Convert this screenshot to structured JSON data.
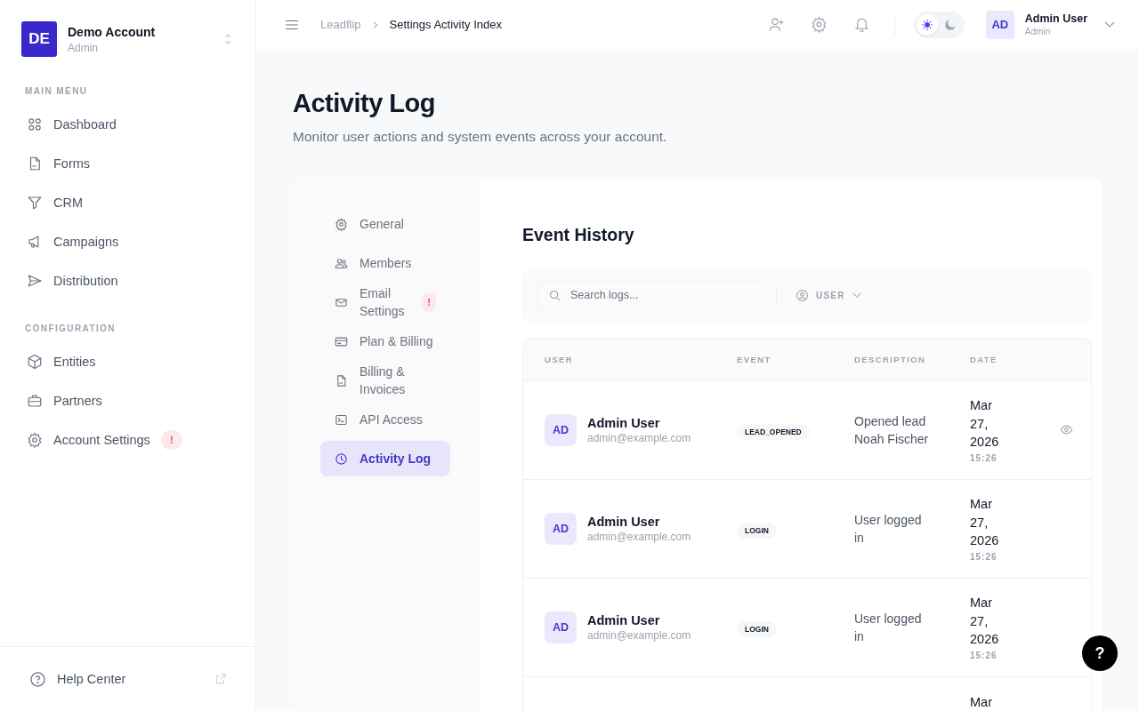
{
  "account": {
    "initials": "DE",
    "name": "Demo Account",
    "role": "Admin"
  },
  "nav_sections": [
    {
      "title": "MAIN MENU",
      "items": [
        {
          "label": "Dashboard",
          "kind": "grid",
          "selected": false
        },
        {
          "label": "Forms",
          "kind": "doc",
          "selected": false
        },
        {
          "label": "CRM",
          "kind": "funnel",
          "selected": false
        },
        {
          "label": "Campaigns",
          "kind": "megaphone",
          "selected": false
        },
        {
          "label": "Distribution",
          "kind": "send",
          "selected": false
        }
      ]
    },
    {
      "title": "CONFIGURATION",
      "items": [
        {
          "label": "Entities",
          "kind": "cube",
          "selected": false
        },
        {
          "label": "Partners",
          "kind": "briefcase",
          "selected": false
        },
        {
          "label": "Account Settings",
          "kind": "gear",
          "selected": false,
          "badge": "!"
        }
      ]
    }
  ],
  "help": {
    "label": "Help Center"
  },
  "breadcrumb": [
    "Leadflip",
    "Settings Activity Index"
  ],
  "theme_options": [
    {
      "kind": "sun",
      "selected": true
    },
    {
      "kind": "moon",
      "selected": false
    }
  ],
  "user": {
    "initials": "AD",
    "name": "Admin User",
    "role": "Admin"
  },
  "page": {
    "title": "Activity Log",
    "subtitle": "Monitor user actions and system events across your account."
  },
  "settings_nav": [
    {
      "label": "General",
      "kind": "gear",
      "selected": false
    },
    {
      "label": "Members",
      "kind": "users",
      "selected": false
    },
    {
      "label": "Email Settings",
      "kind": "mail",
      "selected": false,
      "badge": "!"
    },
    {
      "label": "Plan & Billing",
      "kind": "card",
      "selected": false
    },
    {
      "label": "Billing & Invoices",
      "kind": "doc",
      "selected": false
    },
    {
      "label": "API Access",
      "kind": "terminal",
      "selected": false
    },
    {
      "label": "Activity Log",
      "kind": "clock",
      "selected": true
    }
  ],
  "section_title": "Event History",
  "search": {
    "placeholder": "Search logs..."
  },
  "filter": {
    "label": "USER"
  },
  "table": {
    "columns": [
      "USER",
      "EVENT",
      "DESCRIPTION",
      "DATE"
    ],
    "rows": [
      {
        "initials": "AD",
        "name": "Admin User",
        "email": "admin@example.com",
        "event": "LEAD_OPENED",
        "description": "Opened lead Noah Fischer",
        "date": "Mar 27, 2026",
        "time": "15:26",
        "view_button": true
      },
      {
        "initials": "AD",
        "name": "Admin User",
        "email": "admin@example.com",
        "event": "LOGIN",
        "description": "User logged in",
        "date": "Mar 27, 2026",
        "time": "15:26",
        "view_button": false
      },
      {
        "initials": "AD",
        "name": "Admin User",
        "email": "admin@example.com",
        "event": "LOGIN",
        "description": "User logged in",
        "date": "Mar 27, 2026",
        "time": "15:26",
        "view_button": false
      },
      {
        "date": "Mar"
      }
    ]
  },
  "help_button": "?"
}
